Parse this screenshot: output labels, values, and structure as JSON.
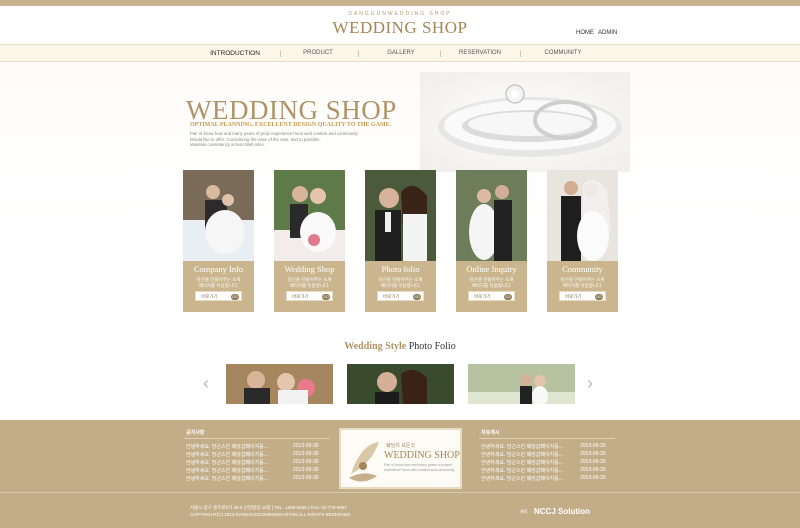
{
  "header": {
    "logo_sub": "DANGGUNWEDDING SHOP",
    "logo": "WEDDING SHOP",
    "home": "HOME",
    "admin": "ADMIN"
  },
  "nav": [
    "INTRODUCTION",
    "PRODUCT",
    "GALLERY",
    "RESERVATION",
    "COMMUNITY"
  ],
  "hero": {
    "title": "WEDDING SHOP",
    "subtitle": "OPTIMAL PLANNING, EXCELLENT DESIGN QUALITY TO THE GAME.",
    "desc1": "Pair of know how and many years of proje experience hoon web content and community",
    "desc2": "Would like to offer. Considering the ease of the user, and to possible.",
    "desc3": "Maintain consistency across Web sites."
  },
  "cards": [
    {
      "title": "Company Info",
      "desc1": "당신을 만들어주는 소개",
      "desc2": "페이지를 이용합니다.",
      "button": "바로가기",
      "go": "GO"
    },
    {
      "title": "Wedding Shop",
      "desc1": "당신을 만들어주는 소개",
      "desc2": "페이지를 이용합니다.",
      "button": "바로가기",
      "go": "GO"
    },
    {
      "title": "Photo folio",
      "desc1": "당신을 만들어주는 소개",
      "desc2": "페이지를 이용합니다.",
      "button": "바로가기",
      "go": "GO"
    },
    {
      "title": "Online Inquiry",
      "desc1": "당신을 만들어주는 소개",
      "desc2": "페이지를 이용합니다.",
      "button": "바로가기",
      "go": "GO"
    },
    {
      "title": "Community",
      "desc1": "당신을 만들어주는 소개",
      "desc2": "페이지를 이용합니다.",
      "button": "바로가기",
      "go": "GO"
    }
  ],
  "folio": {
    "accent": "Wedding Style",
    "rest": "Photo Folio",
    "prev": "‹",
    "next": "›"
  },
  "footer": {
    "left_head": "공지사항",
    "right_head": "자유게시",
    "left_rows": [
      {
        "text": "안녕하세요. 당근스킨 웨딩샵페이지를...",
        "date": "2013-09-30"
      },
      {
        "text": "안녕하세요. 당근스킨 웨딩샵페이지를...",
        "date": "2013-09-30"
      },
      {
        "text": "안녕하세요. 당근스킨 웨딩샵페이지를...",
        "date": "2013-09-30"
      },
      {
        "text": "안녕하세요. 당근스킨 웨딩샵페이지를...",
        "date": "2013-09-30"
      },
      {
        "text": "안녕하세요. 당근스킨 웨딩샵페이지를...",
        "date": "2013-09-30"
      }
    ],
    "right_rows": [
      {
        "text": "안녕하세요. 당근스킨 웨딩샵페이지를...",
        "date": "2013-09-30"
      },
      {
        "text": "안녕하세요. 당근스킨 웨딩샵페이지를...",
        "date": "2013-09-30"
      },
      {
        "text": "안녕하세요. 당근스킨 웨딩샵페이지를...",
        "date": "2013-09-30"
      },
      {
        "text": "안녕하세요. 당근스킨 웨딩샵페이지를...",
        "date": "2013-09-30"
      },
      {
        "text": "안녕하세요. 당근스킨 웨딩샵페이지를...",
        "date": "2013-09-30"
      }
    ],
    "center_small": "웨딩의 모든것",
    "center_title": "WEDDING SHOP",
    "center_desc": "Pair of know how and many years of project experience hoon web content and community",
    "address": "서울시 중구 충무로2가 49-5 신일빌딩 10층  |  TEL. 1588-0586  |  FAX. 02-775-6987",
    "copyright": "COPYRIGHT(C) 2013 DANGGUNCOMMUNICATION ALL RIGHTS RESERVED",
    "brand_prefix": "제작",
    "brand": "NCCJ Solution"
  },
  "colors": {
    "accent": "#c3ad88",
    "title": "#b09468"
  }
}
